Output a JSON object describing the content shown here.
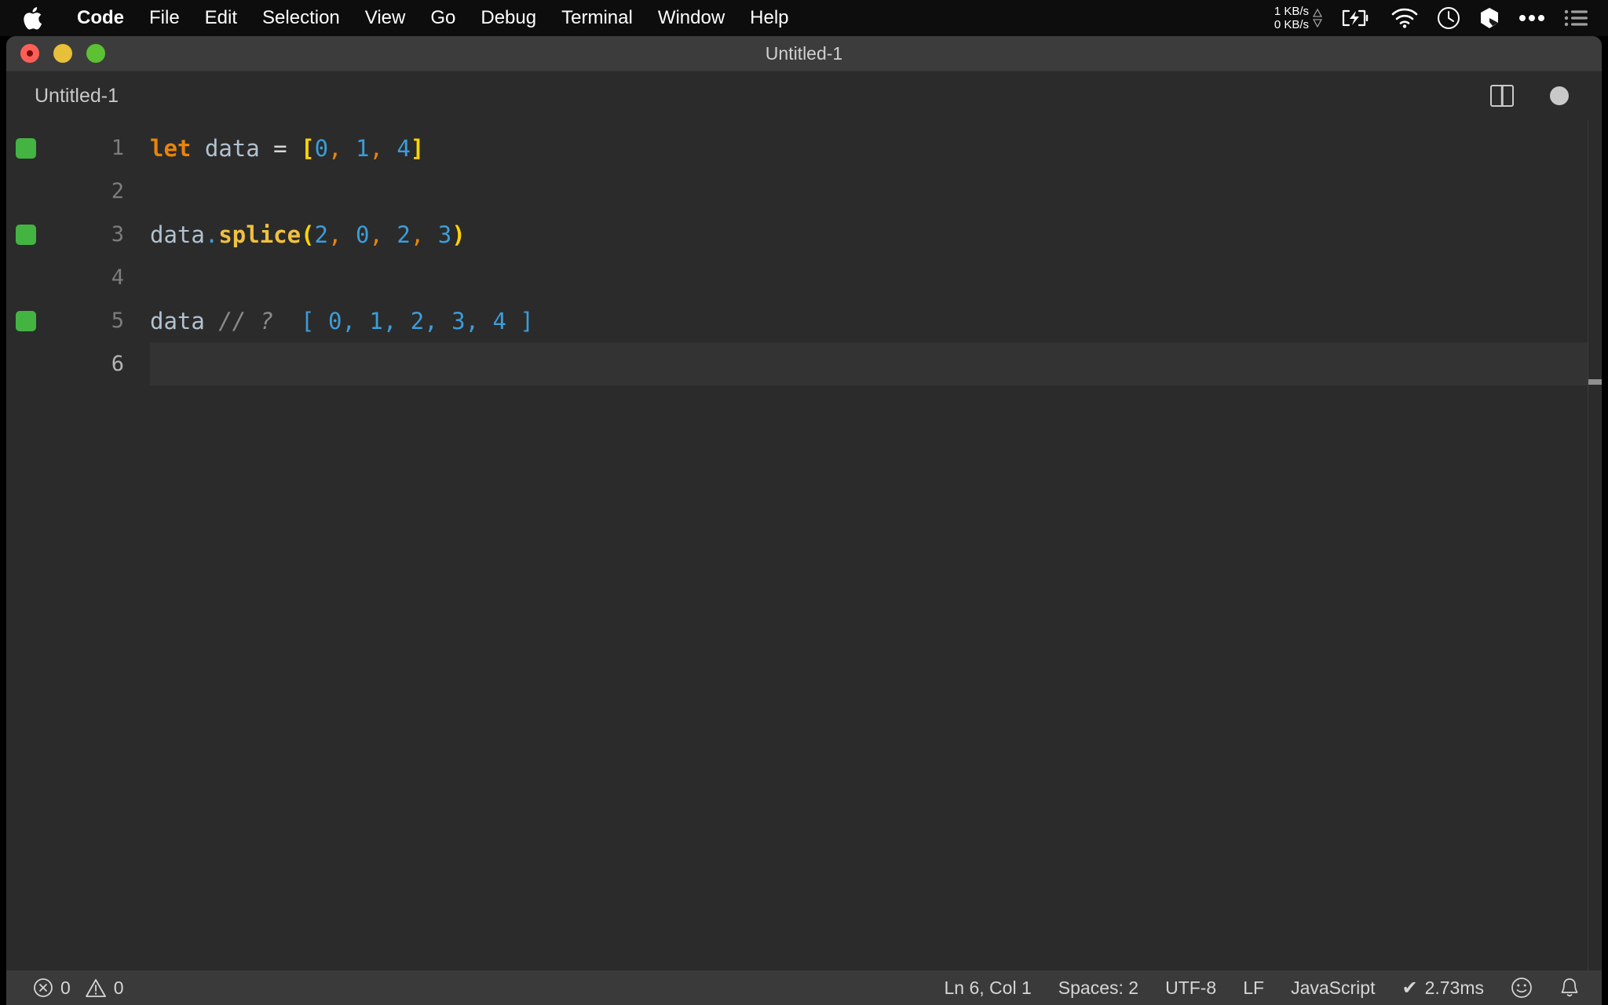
{
  "menubar": {
    "apple_icon": "apple-logo",
    "items": [
      {
        "label": "Code",
        "bold": true
      },
      {
        "label": "File",
        "bold": false
      },
      {
        "label": "Edit",
        "bold": false
      },
      {
        "label": "Selection",
        "bold": false
      },
      {
        "label": "View",
        "bold": false
      },
      {
        "label": "Go",
        "bold": false
      },
      {
        "label": "Debug",
        "bold": false
      },
      {
        "label": "Terminal",
        "bold": false
      },
      {
        "label": "Window",
        "bold": false
      },
      {
        "label": "Help",
        "bold": false
      }
    ],
    "tray": {
      "network_up": "1 KB/s",
      "network_down": "0 KB/s",
      "icons": [
        "battery-charging-icon",
        "wifi-icon",
        "clock-icon",
        "dropbox-icon",
        "ellipsis-icon",
        "control-center-list-icon"
      ]
    }
  },
  "window": {
    "title": "Untitled-1",
    "traffic_lights": [
      "close-button",
      "minimize-button",
      "maximize-button"
    ]
  },
  "tabs": {
    "active": "Untitled-1",
    "actions": [
      "split-editor-icon",
      "unsaved-indicator-dot"
    ]
  },
  "editor": {
    "language": "JavaScript",
    "lines": [
      {
        "number": "1",
        "quokka": true,
        "active": false,
        "tokens": [
          {
            "t": "let",
            "c": "tk-keyword"
          },
          {
            "t": " ",
            "c": "tk-op"
          },
          {
            "t": "data",
            "c": "tk-var"
          },
          {
            "t": " ",
            "c": "tk-op"
          },
          {
            "t": "=",
            "c": "tk-op"
          },
          {
            "t": " ",
            "c": "tk-op"
          },
          {
            "t": "[",
            "c": "tk-bracket-y"
          },
          {
            "t": "0",
            "c": "tk-num"
          },
          {
            "t": ",",
            "c": "tk-comma"
          },
          {
            "t": " ",
            "c": "tk-op"
          },
          {
            "t": "1",
            "c": "tk-num"
          },
          {
            "t": ",",
            "c": "tk-comma"
          },
          {
            "t": " ",
            "c": "tk-op"
          },
          {
            "t": "4",
            "c": "tk-num"
          },
          {
            "t": "]",
            "c": "tk-bracket-y"
          }
        ]
      },
      {
        "number": "2",
        "quokka": false,
        "active": false,
        "tokens": []
      },
      {
        "number": "3",
        "quokka": true,
        "active": false,
        "tokens": [
          {
            "t": "data",
            "c": "tk-var"
          },
          {
            "t": ".",
            "c": "tk-dot"
          },
          {
            "t": "splice",
            "c": "tk-fn"
          },
          {
            "t": "(",
            "c": "tk-bracket-y"
          },
          {
            "t": "2",
            "c": "tk-num"
          },
          {
            "t": ",",
            "c": "tk-comma"
          },
          {
            "t": " ",
            "c": "tk-op"
          },
          {
            "t": "0",
            "c": "tk-num"
          },
          {
            "t": ",",
            "c": "tk-comma"
          },
          {
            "t": " ",
            "c": "tk-op"
          },
          {
            "t": "2",
            "c": "tk-num"
          },
          {
            "t": ",",
            "c": "tk-comma"
          },
          {
            "t": " ",
            "c": "tk-op"
          },
          {
            "t": "3",
            "c": "tk-num"
          },
          {
            "t": ")",
            "c": "tk-bracket-y"
          }
        ]
      },
      {
        "number": "4",
        "quokka": false,
        "active": false,
        "tokens": []
      },
      {
        "number": "5",
        "quokka": true,
        "active": false,
        "tokens": [
          {
            "t": "data",
            "c": "tk-var"
          },
          {
            "t": " ",
            "c": "tk-op"
          },
          {
            "t": "// ?",
            "c": "tk-comment"
          },
          {
            "t": "  ",
            "c": "tk-op"
          },
          {
            "t": "[ 0, 1, 2, 3, 4 ]",
            "c": "tk-result"
          }
        ]
      },
      {
        "number": "6",
        "quokka": false,
        "active": true,
        "tokens": []
      }
    ]
  },
  "statusbar": {
    "error_icon": "error-circle-icon",
    "error_count": "0",
    "warning_icon": "warning-triangle-icon",
    "warning_count": "0",
    "cursor_position": "Ln 6, Col 1",
    "indentation": "Spaces: 2",
    "encoding": "UTF-8",
    "eol": "LF",
    "language_mode": "JavaScript",
    "quokka_time": "2.73ms",
    "quokka_check": "✔",
    "feedback_icon": "smiley-icon",
    "notifications_icon": "bell-icon"
  },
  "colors": {
    "menubar_bg": "#0d0d0d",
    "titlebar_bg": "#3c3c3c",
    "editor_bg": "#2b2b2b",
    "statusbar_bg": "#3a3a3a",
    "quokka_green": "#43b441",
    "keyword_orange": "#e8830c",
    "bracket_yellow": "#ffd500",
    "number_blue": "#3c9dd8",
    "function_gold": "#f0c040"
  }
}
